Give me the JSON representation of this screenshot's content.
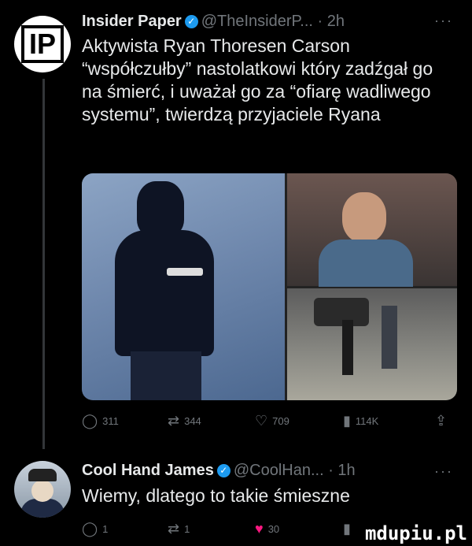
{
  "tweet1": {
    "name": "Insider Paper",
    "handle": "@TheInsiderP...",
    "time": "· 2h",
    "avatar_text": "IP",
    "text": "Aktywista Ryan Thoresen Carson “współczułby” nastolatkowi który zadźgał go na śmierć, i uważał go za “ofiarę wadliwego systemu”, twierdzą przyjaciele Ryana",
    "replies": "311",
    "retweets": "344",
    "likes": "709",
    "views": "114K"
  },
  "tweet2": {
    "name": "Cool Hand James",
    "handle": "@CoolHan...",
    "time": "· 1h",
    "text": "Wiemy, dlatego to takie śmieszne",
    "replies": "1",
    "retweets": "1",
    "likes": "30"
  },
  "more_label": "···",
  "verified_mark": "✓",
  "watermark": "mdupiu.pl",
  "colors": {
    "background": "#000000",
    "text": "#e7e9ea",
    "muted": "#71767b",
    "verified": "#1d9bf0",
    "like_active": "#f91880"
  }
}
